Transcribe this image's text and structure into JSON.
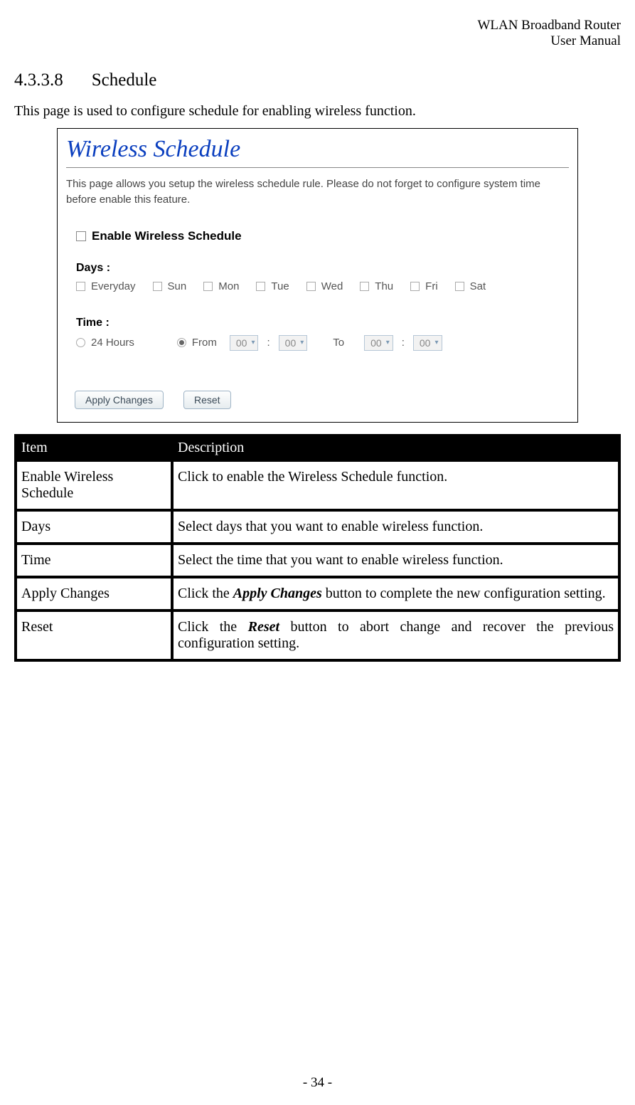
{
  "header": {
    "line1": "WLAN  Broadband  Router",
    "line2": "User  Manual"
  },
  "section": {
    "number": "4.3.3.8",
    "title": "Schedule"
  },
  "intro": "This page is used to configure schedule for enabling wireless function.",
  "panel": {
    "title": "Wireless Schedule",
    "desc": "This page allows you setup the wireless schedule rule. Please do not forget to configure system time before enable this feature.",
    "enable_label": "Enable Wireless Schedule",
    "days_label": "Days :",
    "days": [
      "Everyday",
      "Sun",
      "Mon",
      "Tue",
      "Wed",
      "Thu",
      "Fri",
      "Sat"
    ],
    "time_label": "Time :",
    "time_24": "24 Hours",
    "time_from": "From",
    "time_to": "To",
    "sel_value": "00",
    "sep": ":",
    "apply": "Apply Changes",
    "reset": "Reset"
  },
  "table": {
    "headers": {
      "item": "Item",
      "desc": "Description"
    },
    "rows": [
      {
        "item": "Enable Wireless Schedule",
        "desc": "Click to enable the Wireless Schedule function."
      },
      {
        "item": "Days",
        "desc": "Select days that you want to enable wireless function."
      },
      {
        "item": "Time",
        "desc": "Select the time that you want to enable wireless function."
      },
      {
        "item": "Apply Changes",
        "desc_pre": "Click the ",
        "desc_em": "Apply Changes",
        "desc_post": " button to complete the new configuration setting."
      },
      {
        "item": "Reset",
        "desc_pre": "Click  the  ",
        "desc_em": "Reset",
        "desc_post": "  button  to  abort  change  and  recover  the  previous configuration setting."
      }
    ]
  },
  "footer": "- 34 -"
}
